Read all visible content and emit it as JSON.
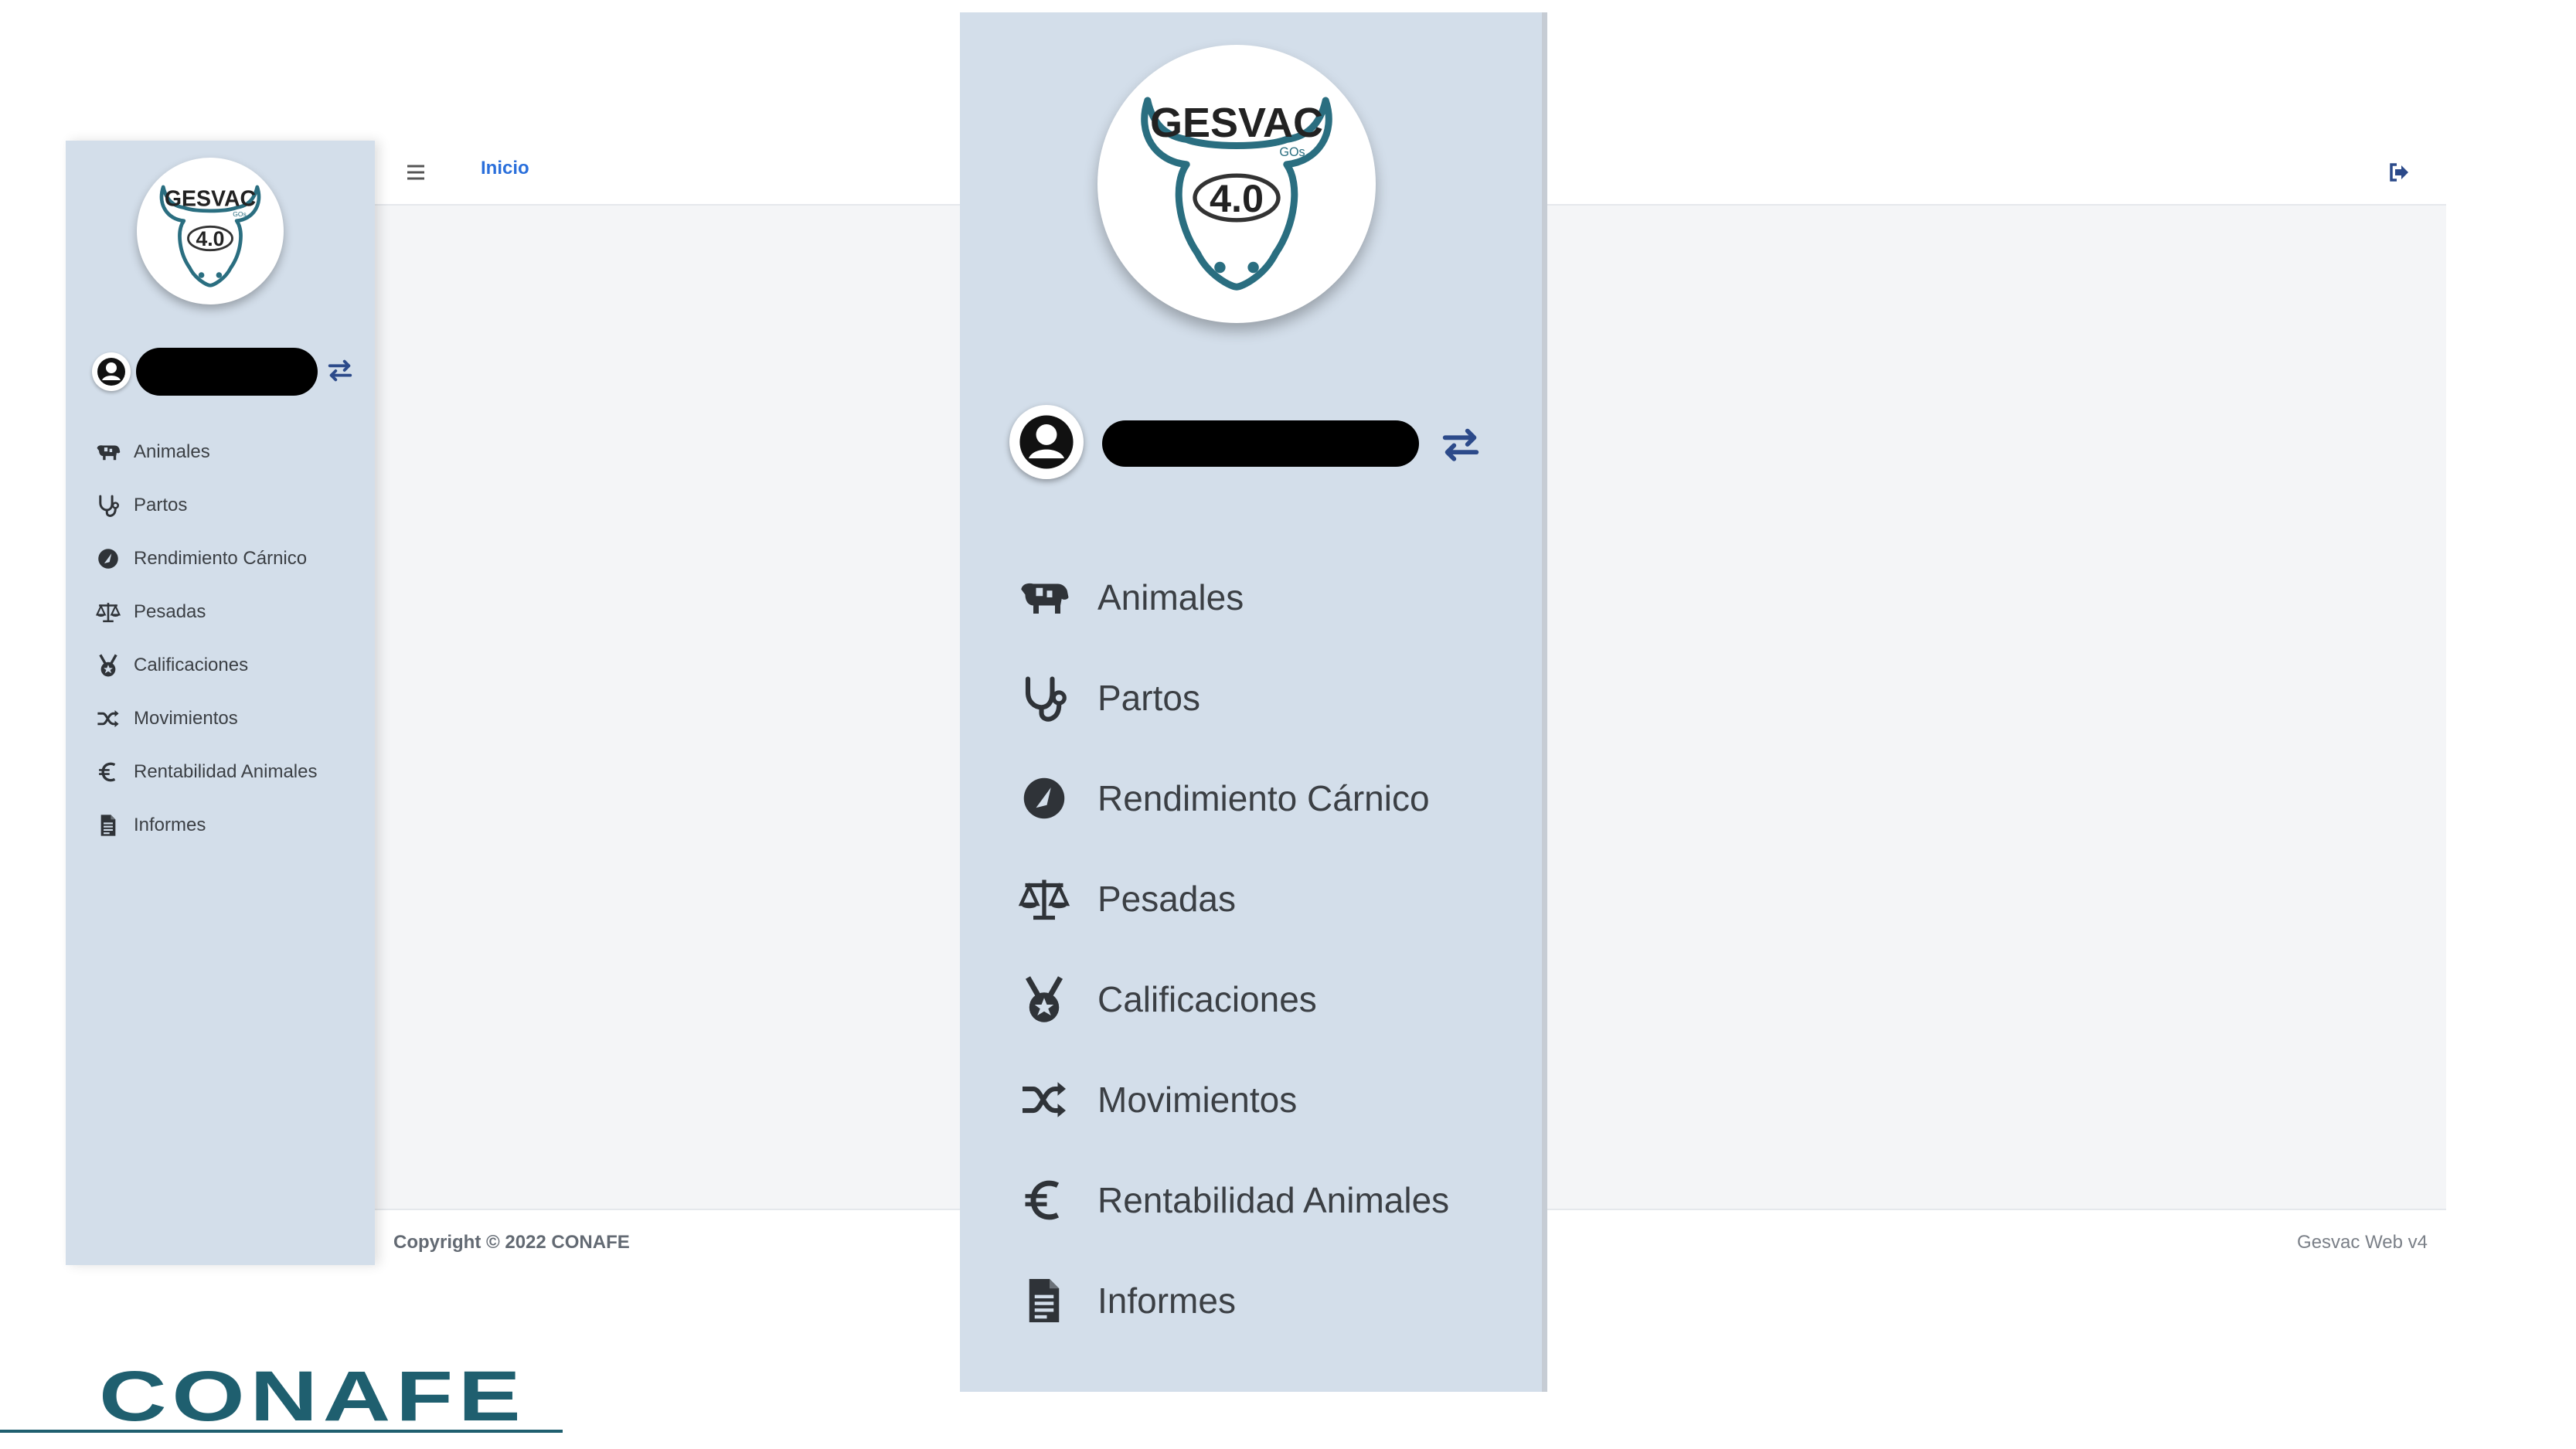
{
  "app": {
    "logo": {
      "brand": "GESVAC",
      "version": "4.0",
      "tag": "GOs"
    },
    "topbar": {
      "breadcrumb": "Inicio",
      "menu_icon": "hamburger-icon",
      "logout_icon": "logout-icon"
    },
    "user": {
      "name_redacted": true,
      "avatar_icon": "user-circle-icon",
      "switch_icon": "switch-arrows-icon"
    },
    "sidebar": {
      "items": [
        {
          "label": "Animales",
          "icon": "cow-icon"
        },
        {
          "label": "Partos",
          "icon": "stethoscope-icon"
        },
        {
          "label": "Rendimiento Cárnico",
          "icon": "gauge-icon"
        },
        {
          "label": "Pesadas",
          "icon": "scale-icon"
        },
        {
          "label": "Calificaciones",
          "icon": "medal-icon"
        },
        {
          "label": "Movimientos",
          "icon": "shuffle-icon"
        },
        {
          "label": "Rentabilidad Animales",
          "icon": "euro-icon"
        },
        {
          "label": "Informes",
          "icon": "document-icon"
        }
      ]
    },
    "footer": {
      "copyright": "Copyright © 2022 CONAFE",
      "version": "Gesvac Web v4"
    }
  },
  "brand": {
    "name": "CONAFE"
  },
  "colors": {
    "sidebar_bg": "#d3deea",
    "link_blue": "#2a6fdb",
    "switch_blue": "#2c4a8a",
    "logo_teal": "#1f5f6f",
    "icon_dark": "#2f3338"
  }
}
